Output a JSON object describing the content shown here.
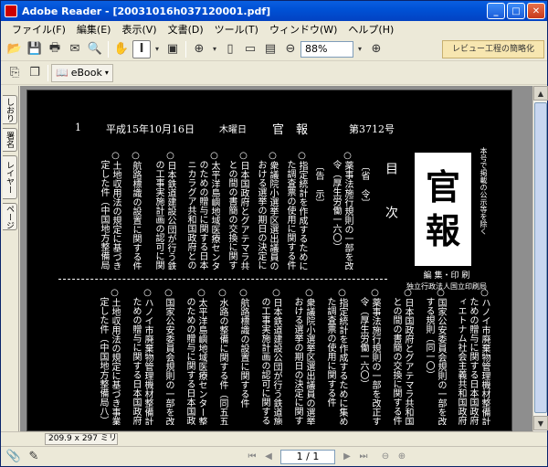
{
  "window": {
    "title": "Adobe Reader - [20031016h037120001.pdf]",
    "minimize": "_",
    "maximize": "□",
    "close": "✕"
  },
  "menu": {
    "items": [
      "ファイル(F)",
      "編集(E)",
      "表示(V)",
      "文書(D)",
      "ツール(T)",
      "ウィンドウ(W)",
      "ヘルプ(H)"
    ]
  },
  "toolbar": {
    "zoom_value": "88%",
    "hint_text": "レビュー工程の簡略化",
    "ebook_label": "eBook"
  },
  "nav_tabs": [
    "しおり",
    "署名",
    "レイヤー",
    "ページ"
  ],
  "status": {
    "page_size": "209.9 x 297 ミリ",
    "page_indicator": "1 / 1"
  },
  "document": {
    "issue_no": "1",
    "date": "平成15年10月16日",
    "weekday": "木曜日",
    "paper_name_small": "官　報",
    "number": "第3712号",
    "masthead_1": "官",
    "masthead_2": "報",
    "toc_title": "目　次",
    "publisher_1": "編 集・印 刷",
    "publisher_2": "独立行政法人国立印刷局",
    "side_info": "本号で掲載の公示等を除く",
    "col1": "〔省　令〕",
    "col2": "○薬事法施行規則の一部を改正する省",
    "col3": "　令（厚生労働一六〇）",
    "col4": "〔告　示〕",
    "col5": "○指定統計を作成するために集められ",
    "col6": "　た調査票の使用に関する件",
    "col7": "○衆議院小選挙区選出議員の選挙に",
    "col8": "　おける選挙の期日の決定に関する件",
    "col9": "○太平洋島嶼地域医療センター整備計画",
    "col10": "　のための贈与に関する日本国政府と",
    "col11": "　ニカラグア共和国政府との間の書簡",
    "col12": "○日本国政府とグアテマラ共和国政府",
    "col13": "　との間の書簡の交換に関する件",
    "col14": "○ハノイ市廃棄物管理機材整備計画の",
    "col15": "　ための贈与に関する日本国政府とヴ",
    "col16": "　ィエトナム社会主義共和国政府との",
    "col17": "○国家公安委員会規則の一部を改正",
    "col18": "　する規則（同一〇）",
    "col19": "○土地収用法の規定に基づき事業を認",
    "col20": "　定した件（中国地方整備局八）",
    "col21": "○航路標識の設置に関する件",
    "col22": "○水路の整備に関する件（同五五）",
    "col23": "○日本鉄道建設公団が行う鉄道施設",
    "col24": "　の工事実施計画の認可に関する件"
  }
}
